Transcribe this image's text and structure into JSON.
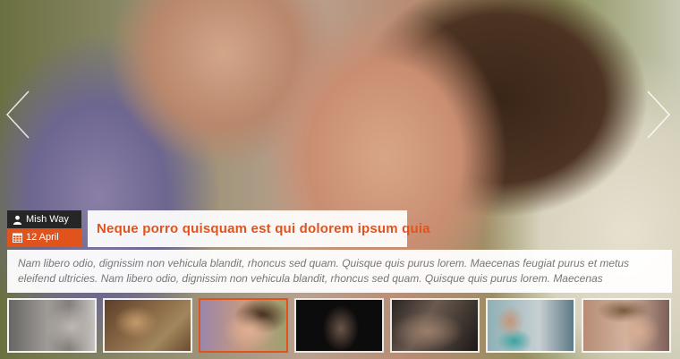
{
  "slide": {
    "author": "Mish Way",
    "date": "12 April",
    "title": "Neque porro quisquam est qui dolorem ipsum quia",
    "description": "Nam libero odio, dignissim non vehicula blandit, rhoncus sed quam. Quisque quis purus lorem. Maecenas feugiat purus et metus eleifend ultricies. Nam libero odio, dignissim non vehicula blandit, rhoncus sed quam. Quisque quis purus lorem. Maecenas"
  },
  "icons": {
    "author": "user-icon",
    "date": "calendar-icon",
    "prev": "chevron-left-icon",
    "next": "chevron-right-icon"
  },
  "colors": {
    "accent": "#e0531d",
    "author_bg": "#262626"
  },
  "thumbnails": {
    "count": 7,
    "active_index": 2
  }
}
